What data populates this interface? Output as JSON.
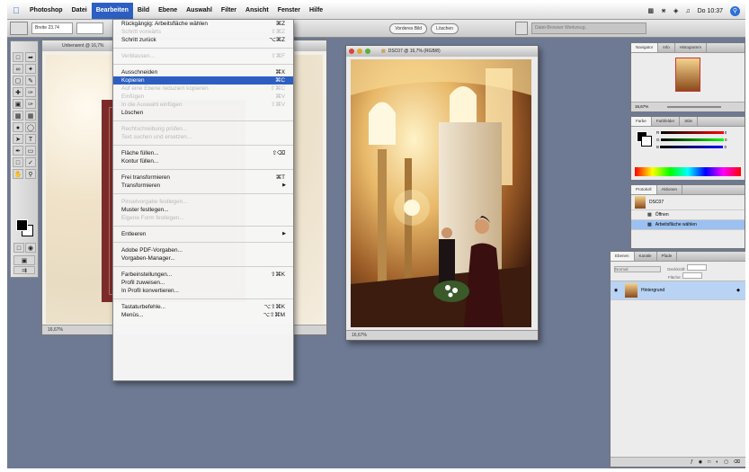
{
  "menubar": {
    "app_name": "Photoshop",
    "items": [
      "Datei",
      "Bearbeiten",
      "Bild",
      "Ebene",
      "Auswahl",
      "Filter",
      "Ansicht",
      "Fenster",
      "Hilfe"
    ],
    "active_index": 1,
    "clock": "Do 10:37"
  },
  "options_bar": {
    "mode_value": "Breite 23.74",
    "btn_front": "Vorderes Bild",
    "btn_clear": "Löschen",
    "palette_field": "Datei-Browser Werkzeug.."
  },
  "edit_menu": {
    "items": [
      {
        "label": "Rückgängig: Arbeitsfläche wählen",
        "shortcut": "⌘Z",
        "disabled": false
      },
      {
        "label": "Schritt vorwärts",
        "shortcut": "⇧⌘Z",
        "disabled": true
      },
      {
        "label": "Schritt zurück",
        "shortcut": "⌥⌘Z",
        "disabled": false
      },
      {
        "sep": true
      },
      {
        "label": "Verblassen...",
        "shortcut": "⇧⌘F",
        "disabled": true
      },
      {
        "sep": true
      },
      {
        "label": "Ausschneiden",
        "shortcut": "⌘X",
        "disabled": false
      },
      {
        "label": "Kopieren",
        "shortcut": "⌘C",
        "disabled": false,
        "highlight": true
      },
      {
        "label": "Auf eine Ebene reduziert kopieren",
        "shortcut": "⇧⌘C",
        "disabled": true
      },
      {
        "label": "Einfügen",
        "shortcut": "⌘V",
        "disabled": true
      },
      {
        "label": "In die Auswahl einfügen",
        "shortcut": "⇧⌘V",
        "disabled": true
      },
      {
        "label": "Löschen",
        "shortcut": "",
        "disabled": false
      },
      {
        "sep": true
      },
      {
        "label": "Rechtschreibung prüfen...",
        "shortcut": "",
        "disabled": true
      },
      {
        "label": "Text suchen und ersetzen...",
        "shortcut": "",
        "disabled": true
      },
      {
        "sep": true
      },
      {
        "label": "Fläche füllen...",
        "shortcut": "⇧⌫",
        "disabled": false
      },
      {
        "label": "Kontur füllen...",
        "shortcut": "",
        "disabled": false
      },
      {
        "sep": true
      },
      {
        "label": "Frei transformieren",
        "shortcut": "⌘T",
        "disabled": false
      },
      {
        "label": "Transformieren",
        "shortcut": "",
        "disabled": false,
        "submenu": true
      },
      {
        "sep": true
      },
      {
        "label": "Pinselvorgabe festlegen...",
        "shortcut": "",
        "disabled": true
      },
      {
        "label": "Muster festlegen...",
        "shortcut": "",
        "disabled": false
      },
      {
        "label": "Eigene Form festlegen...",
        "shortcut": "",
        "disabled": true
      },
      {
        "sep": true
      },
      {
        "label": "Entleeren",
        "shortcut": "",
        "disabled": false,
        "submenu": true
      },
      {
        "sep": true
      },
      {
        "label": "Adobe PDF-Vorgaben...",
        "shortcut": "",
        "disabled": false
      },
      {
        "label": "Vorgaben-Manager...",
        "shortcut": "",
        "disabled": false
      },
      {
        "sep": true
      },
      {
        "label": "Farbeinstellungen...",
        "shortcut": "⇧⌘K",
        "disabled": false
      },
      {
        "label": "Profil zuweisen...",
        "shortcut": "",
        "disabled": false
      },
      {
        "label": "In Profil konvertieren...",
        "shortcut": "",
        "disabled": false
      },
      {
        "sep": true
      },
      {
        "label": "Tastaturbefehle...",
        "shortcut": "⌥⇧⌘K",
        "disabled": false
      },
      {
        "label": "Menüs...",
        "shortcut": "⌥⇧⌘M",
        "disabled": false
      }
    ]
  },
  "doc1": {
    "title": "Unbenannt @ 16,7%",
    "zoom": "16,67%"
  },
  "photo_window": {
    "title": "DSC07 @ 16,7% (RGB/8)",
    "zoom": "16,67%"
  },
  "navigator": {
    "tabs": [
      "Navigator",
      "Info",
      "Histogramm"
    ],
    "zoom": "16,67%"
  },
  "color_palette": {
    "tabs": [
      "Farbe",
      "Farbfelder",
      "Stile"
    ],
    "channels": [
      "R",
      "G",
      "B"
    ],
    "values": [
      "0",
      "0",
      "0"
    ]
  },
  "history": {
    "tabs": [
      "Protokoll",
      "Aktionen"
    ],
    "items": [
      "DSC07",
      "Öffnen",
      "Arbeitsfläche wählen"
    ]
  },
  "layers": {
    "tabs": [
      "Ebenen",
      "Kanäle",
      "Pfade"
    ],
    "blend_mode": "Normal",
    "opacity": "Deckkraft:",
    "fill": "Fläche:",
    "layer_name": "Hintergrund"
  },
  "colors": {
    "accent": "#2d5fc2",
    "desktop": "#6e7a94",
    "frame_red": "#7b2c2a"
  }
}
